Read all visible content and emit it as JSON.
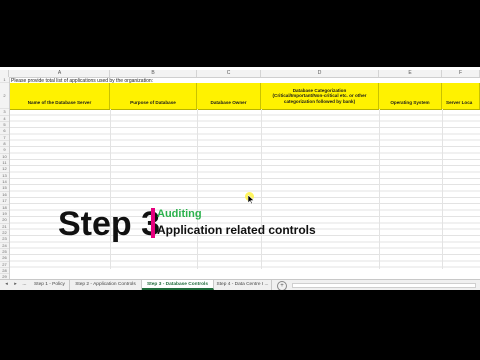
{
  "sheet": {
    "instruction": "Please provide total list of applications used by the organization:",
    "columns": [
      "A",
      "B",
      "C",
      "D",
      "E",
      "F"
    ],
    "headers": [
      "Name of the Database Server",
      "Purpose of Database",
      "Database Owner",
      "Database Categorization\n(Critical/Important/Non-critical etc. or other categorization followed by bank)",
      "Operating System",
      "Server Loca"
    ],
    "row_numbers": [
      "1",
      "2",
      "3",
      "4",
      "5",
      "6",
      "7",
      "8",
      "9",
      "10",
      "11",
      "12",
      "13",
      "14",
      "15",
      "16",
      "17",
      "18",
      "19",
      "20",
      "21",
      "22",
      "23",
      "24",
      "25",
      "26",
      "27",
      "28",
      "29",
      "30"
    ]
  },
  "tabs": {
    "items": [
      {
        "label": "Step 1 - Policy",
        "active": false
      },
      {
        "label": "Step 2 - Application Controls",
        "active": false
      },
      {
        "label": "Step 3 - Database Controls",
        "active": true
      },
      {
        "label": "Step 4 - Data Centre I ...",
        "active": false
      }
    ],
    "nav_prev": "◂",
    "nav_next": "▸",
    "add_sheet": "+",
    "more": "..."
  },
  "overlay": {
    "step_title": "Step 3",
    "subtitle1": "Auditing",
    "subtitle2": "Application related controls",
    "accent_color": "#e6007e",
    "subtitle1_color": "#2bb24c"
  },
  "colors": {
    "header_fill": "#fff200",
    "active_tab": "#1e6b3a"
  }
}
